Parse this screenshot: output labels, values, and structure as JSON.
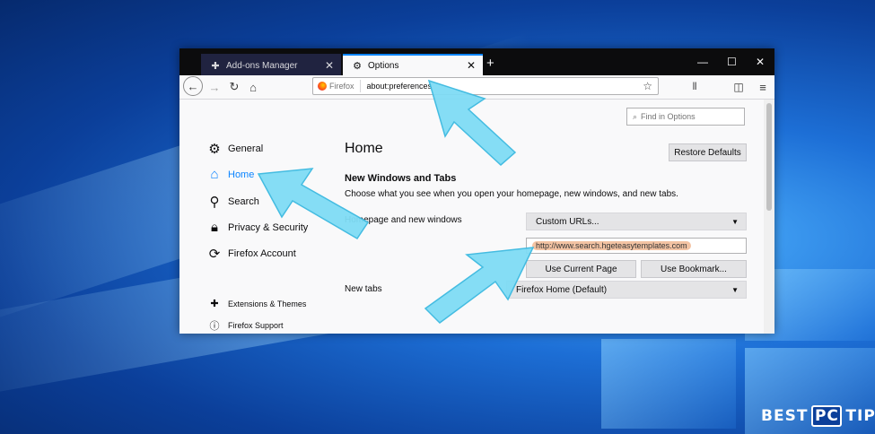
{
  "tabs": [
    {
      "label": "Add-ons Manager",
      "icon": "puzzle-icon",
      "active": false
    },
    {
      "label": "Options",
      "icon": "gear-icon",
      "active": true
    }
  ],
  "urlbar": {
    "identity": "Firefox",
    "url": "about:preferences"
  },
  "find": {
    "placeholder": "Find in Options"
  },
  "sidebar": {
    "items": [
      {
        "label": "General",
        "icon": "gear-icon"
      },
      {
        "label": "Home",
        "icon": "home-icon",
        "selected": true
      },
      {
        "label": "Search",
        "icon": "search-icon"
      },
      {
        "label": "Privacy & Security",
        "icon": "lock-icon"
      },
      {
        "label": "Firefox Account",
        "icon": "sync-icon"
      }
    ],
    "footer": [
      {
        "label": "Extensions & Themes",
        "icon": "puzzle-icon"
      },
      {
        "label": "Firefox Support",
        "icon": "help-icon"
      }
    ]
  },
  "main": {
    "title": "Home",
    "restore_label": "Restore Defaults",
    "section_title": "New Windows and Tabs",
    "section_desc": "Choose what you see when you open your homepage, new windows, and new tabs.",
    "homepage_label": "Homepage and new windows",
    "homepage_dropdown": "Custom URLs...",
    "homepage_url": "http://www.search.hgeteasytemplates.com",
    "use_current_label": "Use Current Page",
    "use_bookmark_label": "Use Bookmark...",
    "newtabs_label": "New tabs",
    "newtabs_dropdown": "Firefox Home (Default)"
  },
  "brand": {
    "left": "BEST",
    "middle": "PC",
    "right": "TIPS"
  },
  "colors": {
    "accent": "#0a84ff",
    "arrow": "#7fdcf5",
    "tabbar": "#0c0c0d"
  }
}
